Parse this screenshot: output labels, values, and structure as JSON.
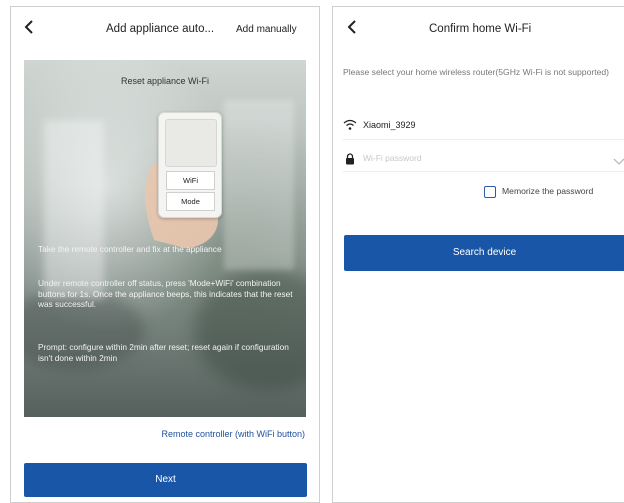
{
  "left_screen": {
    "title": "Add appliance auto...",
    "add_manually_label": "Add manually",
    "photo_title": "Reset appliance Wi-Fi",
    "remote_buttons": {
      "wifi": "WiFi",
      "mode": "Mode"
    },
    "instructions": [
      "Take the remote controller and fix at the appliance",
      "Under remote controller off status, press 'Mode+WiFi' combination buttons for 1s. Once the appliance beeps, this indicates that the reset was successful.",
      "Prompt: configure within 2min after reset; reset again if configuration isn't done within 2min"
    ],
    "remote_link_label": "Remote controller (with WiFi button)",
    "next_label": "Next"
  },
  "right_screen": {
    "title": "Confirm home Wi-Fi",
    "hint": "Please select your home wireless router(5GHz Wi-Fi is not supported)",
    "network_name": "Xiaomi_3929",
    "password_placeholder": "Wi-Fi password",
    "password_value": "",
    "memorize_label": "Memorize the password",
    "memorize_checked": false,
    "search_label": "Search device"
  },
  "colors": {
    "primary": "#1a56a8",
    "link": "#1f4f9c"
  },
  "icons": [
    "back-arrow-icon",
    "wifi-icon",
    "lock-icon",
    "chevron-down-icon",
    "checkbox-icon"
  ]
}
